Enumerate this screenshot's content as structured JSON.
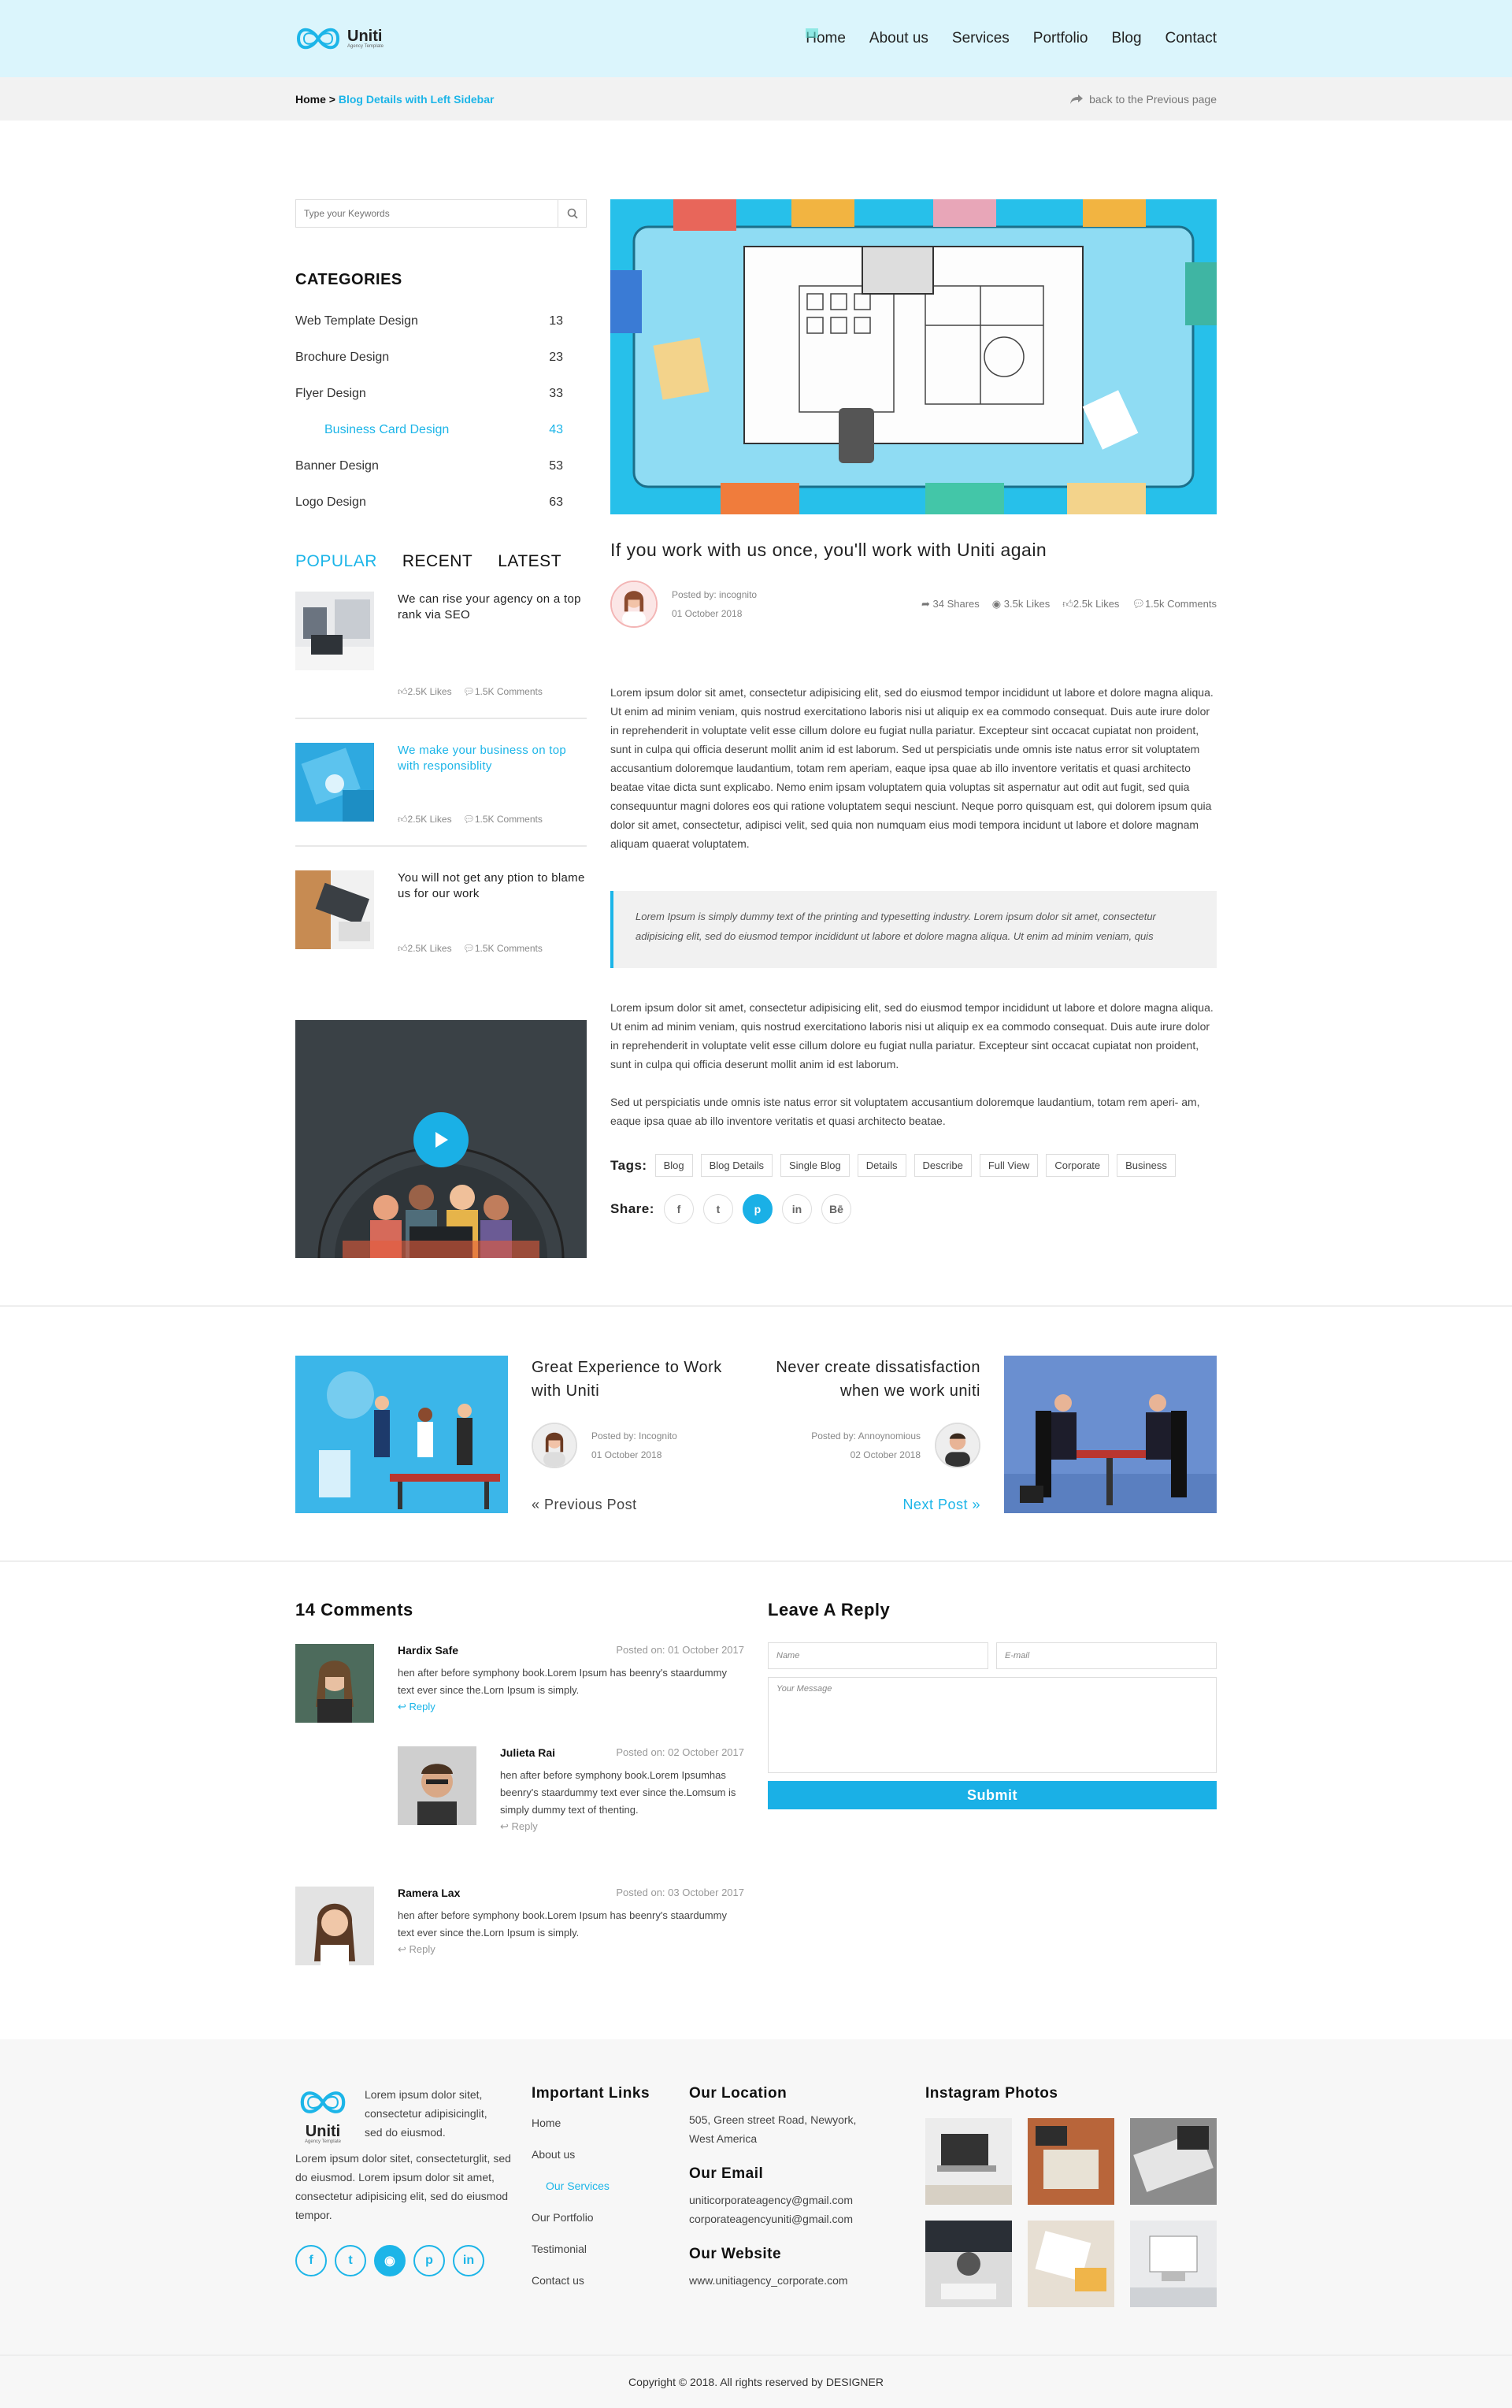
{
  "brand": {
    "name": "Uniti",
    "tagline": "Agency Template",
    "color": "#1cb5e8"
  },
  "nav": [
    "Home",
    "About us",
    "Services",
    "Portfolio",
    "Blog",
    "Contact"
  ],
  "breadcrumb": {
    "home": "Home",
    "sep": ">",
    "current": "Blog Details with Left Sidebar",
    "back": "back to the Previous page"
  },
  "search": {
    "placeholder": "Type your Keywords"
  },
  "categories": {
    "heading": "CATEGORIES",
    "items": [
      {
        "label": "Web Template Design",
        "count": "13"
      },
      {
        "label": "Brochure Design",
        "count": "23"
      },
      {
        "label": "Flyer Design",
        "count": "33"
      },
      {
        "label": "Business Card Design",
        "count": "43"
      },
      {
        "label": "Banner Design",
        "count": "53"
      },
      {
        "label": "Logo Design",
        "count": "63"
      }
    ]
  },
  "tabs": [
    "POPULAR",
    "RECENT",
    "LATEST"
  ],
  "popular": [
    {
      "title": "We can rise your agency on a top rank via SEO",
      "likes": "2.5K Likes",
      "comments": "1.5K Comments"
    },
    {
      "title": "We make your business on top with responsiblity",
      "likes": "2.5K Likes",
      "comments": "1.5K Comments"
    },
    {
      "title": "You will not get any ption to blame us for our work",
      "likes": "2.5K Likes",
      "comments": "1.5K Comments"
    }
  ],
  "article": {
    "title": "If you work with us once, you'll work with Uniti again",
    "posted_by": "Posted by: incognito",
    "date": "01 October 2018",
    "shares": "34 Shares",
    "views": "3.5k Likes",
    "likes": "2.5k Likes",
    "comments": "1.5k Comments",
    "p1": "Lorem ipsum dolor sit amet, consectetur adipisicing elit, sed do eiusmod tempor incididunt ut labore et dolore magna aliqua. Ut enim ad minim veniam, quis nostrud exercitationo laboris nisi ut aliquip ex ea commodo consequat. Duis aute irure dolor in reprehenderit in voluptate velit esse cillum dolore eu fugiat nulla pariatur. Excepteur sint occacat cupiatat non proident, sunt in culpa qui officia deserunt mollit anim id est laborum. Sed ut perspiciatis unde omnis iste natus error sit voluptatem accusantium doloremque laudantium, totam rem aperiam, eaque ipsa quae ab illo inventore veritatis et quasi architecto beatae vitae dicta sunt explicabo. Nemo enim ipsam voluptatem quia voluptas sit aspernatur aut odit aut fugit, sed quia consequuntur magni dolores eos qui ratione voluptatem sequi nesciunt. Neque porro quisquam est, qui dolorem ipsum quia dolor sit amet, consectetur, adipisci velit, sed quia non numquam eius modi tempora incidunt ut labore et dolore magnam aliquam quaerat voluptatem.",
    "quote": "Lorem Ipsum is simply dummy text of the printing and typesetting industry. Lorem ipsum dolor sit amet, consectetur adipisicing elit, sed do eiusmod tempor incididunt ut labore et dolore magna aliqua. Ut enim ad minim veniam, quis",
    "p2": "Lorem ipsum dolor sit amet, consectetur adipisicing elit, sed do eiusmod tempor incididunt ut labore et dolore magna aliqua. Ut enim ad minim veniam, quis nostrud exercitationo laboris nisi ut aliquip ex ea commodo consequat. Duis aute irure dolor in reprehenderit in voluptate velit esse cillum dolore eu fugiat nulla pariatur. Excepteur sint occacat cupiatat non proident, sunt in culpa qui officia deserunt mollit anim id est laborum.",
    "p3": "Sed ut perspiciatis unde omnis iste natus error sit voluptatem accusantium doloremque laudantium, totam rem aperi- am, eaque ipsa quae ab illo inventore veritatis et quasi architecto beatae.",
    "tags_label": "Tags:",
    "tags": [
      "Blog",
      "Blog Details",
      "Single Blog",
      "Details",
      "Describe",
      "Full View",
      "Corporate",
      "Business"
    ],
    "share_label": "Share:",
    "share": [
      "f",
      "t",
      "p",
      "in",
      "Bē"
    ]
  },
  "prev": {
    "title": "Great Experience to Work with Uniti",
    "posted_by": "Posted by: Incognito",
    "date": "01 October 2018",
    "link": "Previous Post"
  },
  "next": {
    "title": "Never create dissatisfaction when we work uniti",
    "posted_by": "Posted by: Annoynomious",
    "date": "02 October 2018",
    "link": "Next Post"
  },
  "comments": {
    "heading": "14 Comments",
    "items": [
      {
        "name": "Hardix Safe",
        "date": "Posted on: 01 October 2017",
        "text": "hen after before symphony book.Lorem Ipsum has beenry's staardummy text ever since the.Lorn Ipsum is simply.",
        "reply": "Reply"
      },
      {
        "name": "Julieta Rai",
        "date": "Posted on: 02 October 2017",
        "text": "hen after before symphony book.Lorem Ipsumhas beenry's staardummy text ever since the.Lomsum is simply dummy text of thenting.",
        "reply": "Reply"
      },
      {
        "name": "Ramera Lax",
        "date": "Posted on: 03 October 2017",
        "text": "hen after before symphony book.Lorem Ipsum has beenry's staardummy text ever since the.Lorn Ipsum is simply.",
        "reply": "Reply"
      }
    ]
  },
  "reply_form": {
    "heading": "Leave A Reply",
    "name": "Name",
    "email": "E-mail",
    "message": "Your Message",
    "submit": "Submit"
  },
  "footer": {
    "about_short": "Lorem ipsum dolor sitet, consectetur adipisicinglit, sed do eiusmod.",
    "about": "Lorem ipsum dolor sitet, consecteturglit, sed do eiusmod. Lorem ipsum dolor sit amet, consectetur adipisicing elit, sed do eiusmod tempor.",
    "links_heading": "Important Links",
    "links": [
      "Home",
      "About us",
      "Our Services",
      "Our Portfolio",
      "Testimonial",
      "Contact us"
    ],
    "location_heading": "Our Location",
    "location": "505, Green street Road, Newyork, West America",
    "email_heading": "Our Email",
    "email1": "uniticorporateagency@gmail.com",
    "email2": "corporateagencyuniti@gmail.com",
    "website_heading": "Our Website",
    "website": "www.unitiagency_corporate.com",
    "insta_heading": "Instagram Photos",
    "social": [
      "f",
      "t",
      "◉",
      "p",
      "in"
    ],
    "copyright": "Copyright © 2018. All rights reserved by DESIGNER"
  }
}
